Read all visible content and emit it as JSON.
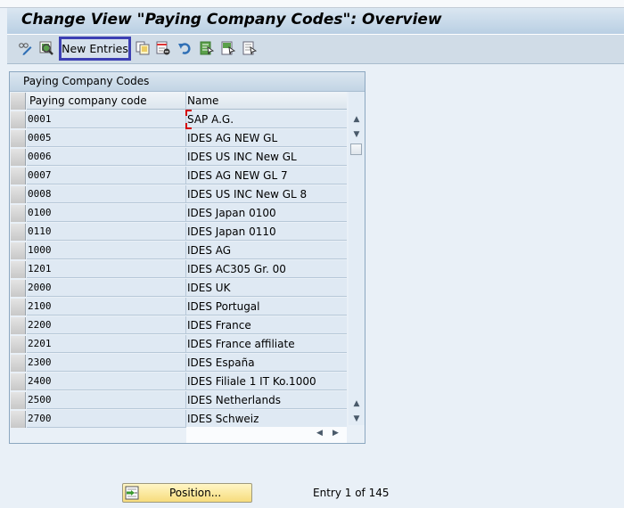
{
  "window": {
    "title": "Change View \"Paying Company Codes\": Overview"
  },
  "toolbar": {
    "icons": [
      "display-change-icon",
      "details-icon",
      "copy-as-icon",
      "delete-icon",
      "undo-change-icon",
      "select-all-icon",
      "select-block-icon",
      "deselect-all-icon"
    ],
    "new_entries_label": "New Entries"
  },
  "panel": {
    "title": "Paying Company Codes",
    "columns": [
      "Paying company code",
      "Name"
    ],
    "rows": [
      {
        "code": "0001",
        "name": "SAP A.G."
      },
      {
        "code": "0005",
        "name": "IDES AG NEW GL"
      },
      {
        "code": "0006",
        "name": "IDES US INC New GL"
      },
      {
        "code": "0007",
        "name": "IDES AG NEW GL 7"
      },
      {
        "code": "0008",
        "name": "IDES US INC New GL 8"
      },
      {
        "code": "0100",
        "name": "IDES Japan 0100"
      },
      {
        "code": "0110",
        "name": "IDES Japan 0110"
      },
      {
        "code": "1000",
        "name": "IDES AG"
      },
      {
        "code": "1201",
        "name": "IDES AC305 Gr. 00"
      },
      {
        "code": "2000",
        "name": "IDES UK"
      },
      {
        "code": "2100",
        "name": "IDES Portugal"
      },
      {
        "code": "2200",
        "name": "IDES France"
      },
      {
        "code": "2201",
        "name": "IDES France affiliate"
      },
      {
        "code": "2300",
        "name": "IDES España"
      },
      {
        "code": "2400",
        "name": "IDES Filiale 1 IT Ko.1000"
      },
      {
        "code": "2500",
        "name": "IDES Netherlands"
      },
      {
        "code": "2700",
        "name": "IDES Schweiz"
      }
    ]
  },
  "footer": {
    "position_label": "Position...",
    "entry_status": "Entry 1 of 145"
  }
}
